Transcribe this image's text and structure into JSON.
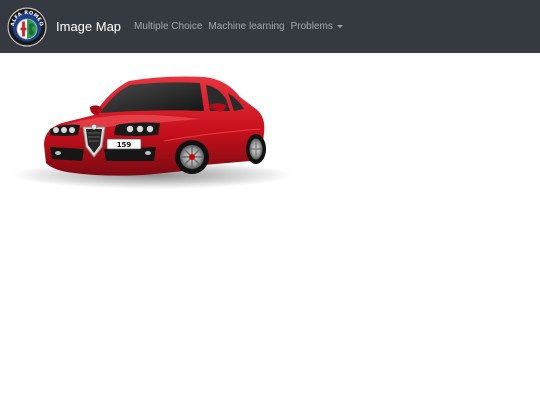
{
  "navbar": {
    "brand_label": "Image Map",
    "logo_text": "ALFA ROMEO",
    "links": [
      {
        "label": "Multiple Choice"
      },
      {
        "label": "Machine learning"
      },
      {
        "label": "Problems",
        "has_dropdown": true
      }
    ],
    "background_color": "#343a40"
  },
  "main": {
    "car_image": {
      "plate_text": "159",
      "body_color": "#c8101c",
      "icon": "alfa-romeo-159-car"
    }
  }
}
